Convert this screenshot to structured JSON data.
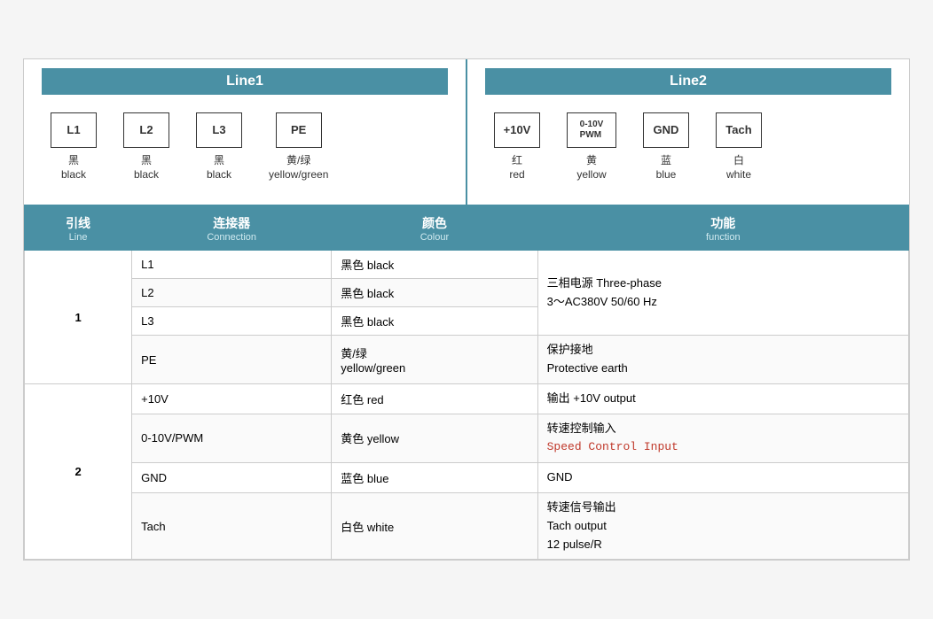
{
  "line1": {
    "header": "Line1",
    "connectors": [
      {
        "id": "L1",
        "zh": "黑",
        "en": "black"
      },
      {
        "id": "L2",
        "zh": "黑",
        "en": "black"
      },
      {
        "id": "L3",
        "zh": "黑",
        "en": "black"
      },
      {
        "id": "PE",
        "zh": "黄/绿",
        "en": "yellow/green"
      }
    ]
  },
  "line2": {
    "header": "Line2",
    "connectors": [
      {
        "id": "+10V",
        "zh": "红",
        "en": "red"
      },
      {
        "id": "0-10V\nPWM",
        "zh": "黄",
        "en": "yellow"
      },
      {
        "id": "GND",
        "zh": "蓝",
        "en": "blue"
      },
      {
        "id": "Tach",
        "zh": "白",
        "en": "white"
      }
    ]
  },
  "table": {
    "headers": [
      {
        "zh": "引线",
        "en": "Line"
      },
      {
        "zh": "连接器",
        "en": "Connection"
      },
      {
        "zh": "颜色",
        "en": "Colour"
      },
      {
        "zh": "功能",
        "en": "function"
      }
    ],
    "groups": [
      {
        "label": "1",
        "rows": [
          {
            "connection": "L1",
            "colour": "黑色 black",
            "function": ""
          },
          {
            "connection": "L2",
            "colour": "黑色 black",
            "function": "三相电源 Three-phase\n3～AC380V 50/60 Hz"
          },
          {
            "connection": "L3",
            "colour": "黑色 black",
            "function": ""
          },
          {
            "connection": "PE",
            "colour": "黄/绿\nyellow/green",
            "function": "保护接地\nProtective earth"
          }
        ]
      },
      {
        "label": "2",
        "rows": [
          {
            "connection": "+10V",
            "colour": "红色 red",
            "function": "输出 +10V output"
          },
          {
            "connection": "0-10V/PWM",
            "colour": "黄色 yellow",
            "function": "转速控制输入\nSpeed Control Input",
            "mono": true
          },
          {
            "connection": "GND",
            "colour": "蓝色 blue",
            "function": "GND"
          },
          {
            "connection": "Tach",
            "colour": "白色 white",
            "function": "转速信号输出\nTach output\n12 pulse/R"
          }
        ]
      }
    ]
  }
}
